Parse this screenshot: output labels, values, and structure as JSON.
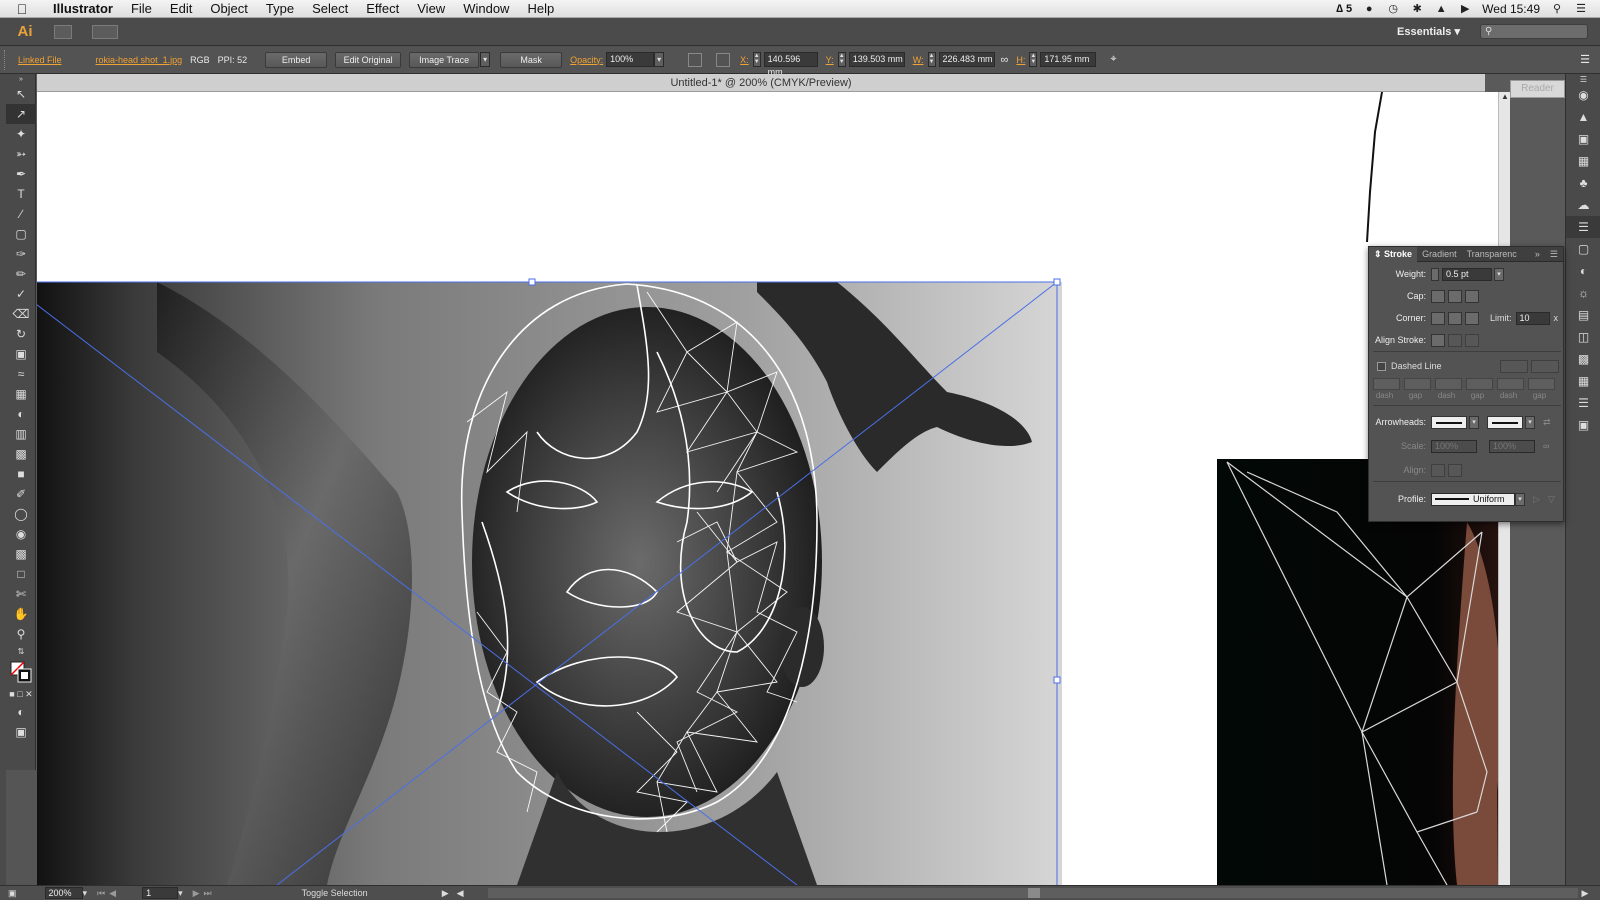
{
  "menubar": {
    "apple_icon": "apple-icon",
    "app_name": "Illustrator",
    "items": [
      "File",
      "Edit",
      "Object",
      "Type",
      "Select",
      "Effect",
      "View",
      "Window",
      "Help"
    ],
    "adobe_badge": "5",
    "clock": "Wed 15:49"
  },
  "appbar": {
    "logo": "Ai",
    "workspace": "Essentials"
  },
  "control": {
    "linked_file": "Linked File",
    "file_name": "rokia-head shot_1.jpg",
    "color_mode": "RGB",
    "ppi": "PPI: 52",
    "embed": "Embed",
    "edit_original": "Edit Original",
    "image_trace": "Image Trace",
    "mask": "Mask",
    "opacity_label": "Opacity:",
    "opacity_value": "100%",
    "x_label": "X:",
    "x_value": "140.596 mm",
    "y_label": "Y:",
    "y_value": "139.503 mm",
    "w_label": "W:",
    "w_value": "226.483 mm",
    "h_label": "H:",
    "h_value": "171.95 mm"
  },
  "document": {
    "title": "Untitled-1* @ 200% (CMYK/Preview)"
  },
  "reader_tab": "Reader",
  "stroke_panel": {
    "tabs": [
      "Stroke",
      "Gradient",
      "Transparenc"
    ],
    "weight_label": "Weight:",
    "weight_value": "0.5 pt",
    "cap_label": "Cap:",
    "corner_label": "Corner:",
    "limit_label": "Limit:",
    "limit_value": "10",
    "limit_unit": "x",
    "align_label": "Align Stroke:",
    "dashed_label": "Dashed Line",
    "dash_labels": [
      "dash",
      "gap",
      "dash",
      "gap",
      "dash",
      "gap"
    ],
    "arrowheads_label": "Arrowheads:",
    "scale_label": "Scale:",
    "scale_a": "100%",
    "scale_b": "100%",
    "align_arrow_label": "Align:",
    "profile_label": "Profile:",
    "profile_value": "Uniform"
  },
  "status": {
    "zoom": "200%",
    "page": "1",
    "mode": "Toggle Selection"
  },
  "colors": {
    "accent_orange": "#f0a233",
    "panel_bg": "#535353",
    "canvas_bg": "#ffffff",
    "selection_blue": "#4a6fe8"
  }
}
